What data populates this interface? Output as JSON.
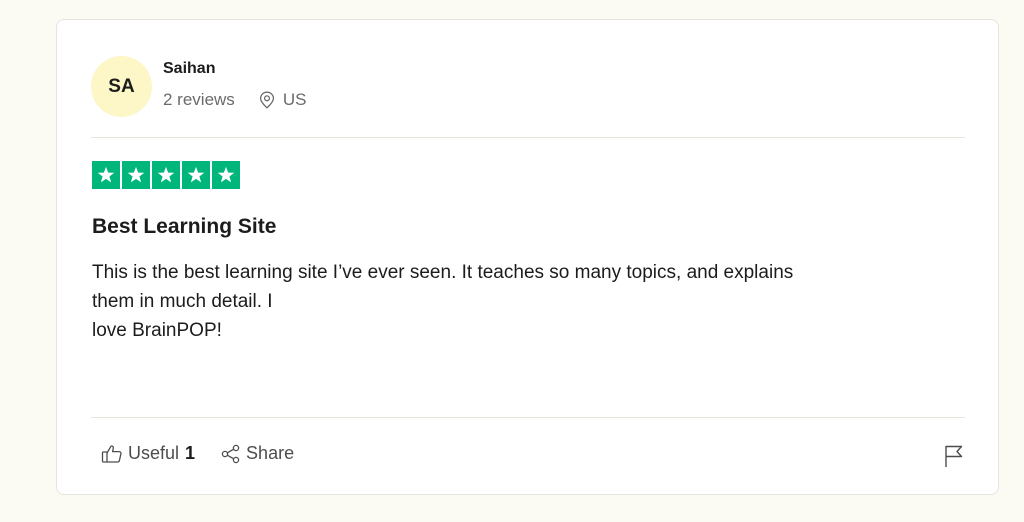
{
  "reviewer": {
    "initials": "SA",
    "name": "Saihan",
    "review_count": "2 reviews",
    "country": "US"
  },
  "rating": {
    "stars": 5,
    "max": 5,
    "color": "#00b67a"
  },
  "review": {
    "title": "Best Learning Site",
    "body_lines": [
      "This is the best learning site I’ve ever seen. It teaches so many topics, and explains",
      "them in much detail. I",
      "love BrainPOP!"
    ]
  },
  "actions": {
    "useful_label": "Useful",
    "useful_count": "1",
    "share_label": "Share"
  },
  "icons": {
    "location": "location-pin-icon",
    "thumbs_up": "thumbs-up-icon",
    "share": "share-icon",
    "flag": "flag-icon"
  },
  "colors": {
    "avatar_bg": "#fdf6c7",
    "star_green": "#00b67a"
  }
}
